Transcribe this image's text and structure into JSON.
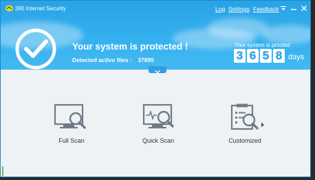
{
  "app": {
    "title": "360 Internet Security"
  },
  "titlebar": {
    "log_label": "Log",
    "settings_label": "Settings",
    "feedback_label": "Feedback",
    "icons": [
      "menu-icon",
      "minimize-icon",
      "close-icon"
    ]
  },
  "status": {
    "title": "Your system is protected !",
    "detected_label": "Detected active files :",
    "detected_count": "37895"
  },
  "protection": {
    "label": "Your system is procted",
    "digits": [
      "3",
      "6",
      "5",
      "8"
    ],
    "unit": "days"
  },
  "scan_options": [
    {
      "label": "Full Scan",
      "icon": "monitor-search-icon"
    },
    {
      "label": "Quick Scan",
      "icon": "monitor-pulse-search-icon"
    },
    {
      "label": "Customized",
      "icon": "clipboard-search-icon"
    }
  ],
  "colors": {
    "header_blue": "#2aa3e6",
    "body_bg": "#eef2f5",
    "icon_gray": "#6f7b86",
    "text_dark": "#333333"
  }
}
